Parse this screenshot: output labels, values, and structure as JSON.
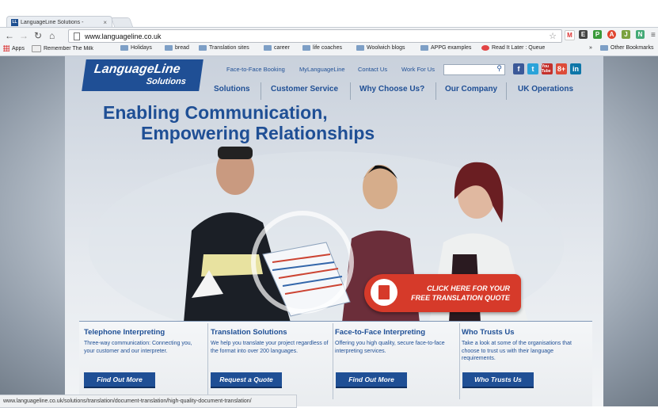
{
  "browser": {
    "tab_title": "LanguageLine Solutions - ",
    "favicon_text": "LL",
    "url": "www.languageline.co.uk",
    "status_url": "www.languageline.co.uk/solutions/translation/document-translation/high-quality-document-translation/"
  },
  "bookmarks": {
    "apps": "Apps",
    "items": [
      "Remember The Milk",
      "Holidays",
      "bread",
      "Translation sites",
      "career",
      "life coaches",
      "Woolwich blogs",
      "APPG examples",
      "Read It Later : Queue"
    ],
    "overflow": "»",
    "other": "Other Bookmarks"
  },
  "site": {
    "logo_line1": "LanguageLine",
    "logo_line2": "Solutions",
    "toplinks": [
      "Face-to-Face Booking",
      "MyLanguageLine",
      "Contact Us",
      "Work For Us"
    ],
    "nav": [
      "Solutions",
      "Customer Service",
      "Why Choose Us?",
      "Our Company",
      "UK Operations"
    ],
    "headline1": "Enabling Communication,",
    "headline2": "Empowering Relationships",
    "social": [
      "f",
      "t",
      "You Tube",
      "8+",
      "in"
    ],
    "cta_line1": "CLICK HERE FOR YOUR",
    "cta_line2": "FREE TRANSLATION QUOTE",
    "columns": [
      {
        "title": "Telephone Interpreting",
        "text": "Three-way communication: Connecting you, your customer and our interpreter.",
        "button": "Find Out More"
      },
      {
        "title": "Translation Solutions",
        "text": "We help you translate your project regardless of the format into over 200 languages.",
        "button": "Request a Quote"
      },
      {
        "title": "Face-to-Face Interpreting",
        "text": "Offering you high quality, secure face-to-face interpreting services.",
        "button": "Find Out More"
      },
      {
        "title": "Who Trusts Us",
        "text": "Take a look at some of the organisations that choose to trust us with their language requirements.",
        "button": "Who Trusts Us"
      }
    ]
  },
  "colors": {
    "brand_blue": "#1f4f95",
    "cta_red": "#d63a2a"
  }
}
